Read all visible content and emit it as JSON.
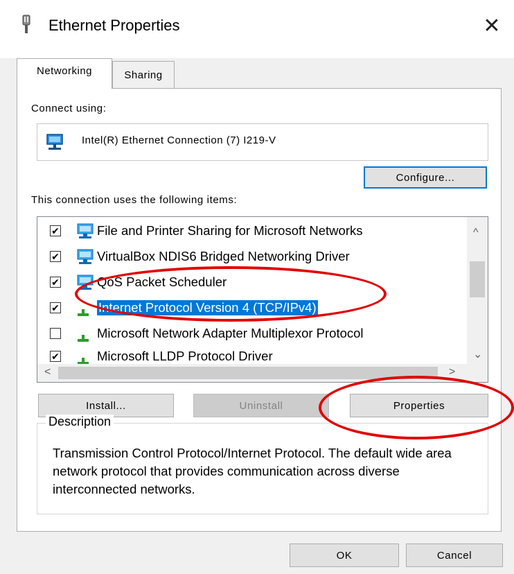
{
  "window": {
    "title": "Ethernet Properties",
    "icon": "network-adapter-icon",
    "close_glyph": "✕"
  },
  "tabs": [
    {
      "label": "Networking",
      "active": true
    },
    {
      "label": "Sharing",
      "active": false
    }
  ],
  "connect_using": {
    "label": "Connect using:",
    "adapter_name": "Intel(R) Ethernet Connection (7) I219-V",
    "adapter_icon": "network-adapter-icon"
  },
  "configure_button": "Configure...",
  "items_label": "This connection uses the following items:",
  "items": [
    {
      "label": "File and Printer Sharing for Microsoft Networks",
      "checked": true,
      "checkmark": "✔",
      "icon": "network-service-icon",
      "selected": false
    },
    {
      "label": "VirtualBox NDIS6 Bridged Networking Driver",
      "checked": true,
      "checkmark": "✔",
      "icon": "network-service-icon",
      "selected": false
    },
    {
      "label": "QoS Packet Scheduler",
      "checked": true,
      "checkmark": "✔",
      "icon": "network-service-icon",
      "selected": false
    },
    {
      "label": "Internet Protocol Version 4 (TCP/IPv4)",
      "checked": true,
      "checkmark": "✔",
      "icon": "protocol-icon",
      "selected": true
    },
    {
      "label": "Microsoft Network Adapter Multiplexor Protocol",
      "checked": false,
      "checkmark": "",
      "icon": "protocol-icon",
      "selected": false
    },
    {
      "label": "Microsoft LLDP Protocol Driver",
      "checked": true,
      "checkmark": "✔",
      "icon": "protocol-icon",
      "selected": false
    }
  ],
  "scroll_arrows": {
    "up": "^",
    "down": "⌄",
    "left": "<",
    "right": ">"
  },
  "buttons": {
    "install": "Install...",
    "uninstall": "Uninstall",
    "properties": "Properties",
    "ok": "OK",
    "cancel": "Cancel"
  },
  "description": {
    "title": "Description",
    "text": "Transmission Control Protocol/Internet Protocol. The default wide area network protocol that provides communication across diverse interconnected networks."
  },
  "colors": {
    "selection": "#0078d7",
    "annotation": "#e20000",
    "focus_border": "#0078d7"
  }
}
